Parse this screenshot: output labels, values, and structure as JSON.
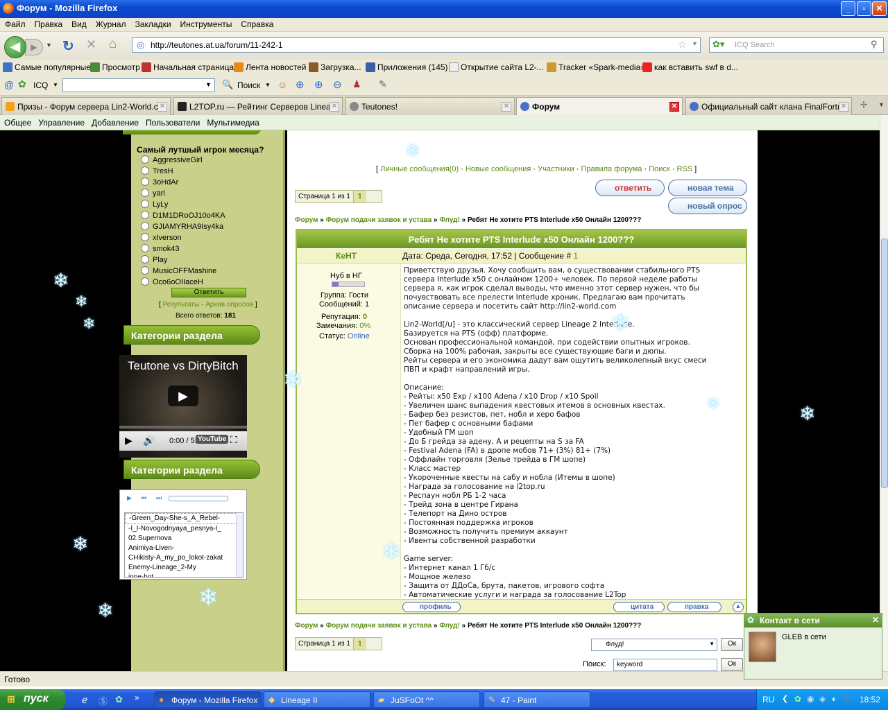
{
  "window": {
    "title": "Форум - Mozilla Firefox"
  },
  "menu": [
    "Файл",
    "Правка",
    "Вид",
    "Журнал",
    "Закладки",
    "Инструменты",
    "Справка"
  ],
  "url": "http://teutones.at.ua/forum/11-242-1",
  "search_placeholder": "ICQ Search",
  "bookmarks": [
    "Самые популярные",
    "Просмотр",
    "Начальная страница",
    "Лента новостей",
    "Загрузка...",
    "Приложения (145)",
    "Открытие сайта L2-...",
    "Tracker «Spark-media»",
    "как вставить swf в d..."
  ],
  "icqbar": {
    "icq_label": "ICQ",
    "search_label": "Поиск"
  },
  "tabs": [
    {
      "label": "Призы - Форум сервера Lin2-World.c...",
      "active": false
    },
    {
      "label": "L2TOP.ru — Рейтинг Серверов Linea...",
      "active": false
    },
    {
      "label": "Teutones!",
      "active": false
    },
    {
      "label": "Форум",
      "active": true
    },
    {
      "label": "Официальный сайт клана FinalFortr...",
      "active": false
    }
  ],
  "site_nav": [
    "Общее",
    "Управление",
    "Добавление",
    "Пользователи",
    "Мультимедиа"
  ],
  "sidebar": {
    "poll_question": "Самый лутшый игрок месяца?",
    "poll_options": [
      "AggressiveGirl",
      "TresH",
      "3oHdAr",
      "yarl",
      "LyLy",
      "D1M1DRoOJ10o4KA",
      "GJIAMYRHA9Isy4ka",
      "xIverson",
      "smok43",
      "Play",
      "MusicOFFMashine",
      "Oco6oOIIaceH"
    ],
    "vote_button": "Ответить",
    "results_link": "Результаты",
    "archive_link": "Архив опросов",
    "total_label": "Всего ответов:",
    "total_value": "181",
    "section_header_1": "Категории раздела",
    "section_header_2": "Категории раздела",
    "video_title": "Teutone vs DirtyBitch",
    "video_time": "0:00 / 5:0",
    "video_brand": "YouTube",
    "playlist": [
      "-Green_Day-She-s_A_Rebel-",
      "-I_I-Novogodnyaya_pesnya-I_",
      "02.Supernova",
      "Animiya-Liven-",
      "CHikisty-A_my_po_lokot-zakat",
      "Enemy-Lineage_2-My",
      "inne-hot"
    ]
  },
  "forum": {
    "top_links": [
      "Личные сообщения(0)",
      "Новые сообщения",
      "Участники",
      "Правила форума",
      "Поиск",
      "RSS"
    ],
    "btn_reply": "ответить",
    "btn_new_topic": "новая тема",
    "btn_new_poll": "новый опрос",
    "pager_label": "Страница 1 из 1",
    "pager_current": "1",
    "breadcrumb": [
      "Форум",
      "Форум подачи заявок и устава",
      "Флуд!"
    ],
    "topic_title": "Ребят Не хотите PTS Interlude x50 Онлайн 1200???",
    "author": "КеНТ",
    "post_date": "Дата: Среда, Сегодня, 17:52 | Сообщение # ",
    "post_num": "1",
    "author_rank": "Нуб в НГ",
    "author_group": "Группа: Гости",
    "author_posts": "Сообщений: 1",
    "rep_label": "Репутация: ",
    "rep_value": "0",
    "warn_label": "Замечания: ",
    "warn_value": "0%",
    "status_label": "Статус: ",
    "status_value": "Online",
    "post_lines": [
      "Приветствую друзья. Хочу сообщить вам, о существовании стабильного PTS",
      "сервера Interlude x50 с онлайном 1200+ человек. По первой неделе работы",
      "сервера я, как игрок сделал выводы, что именно этот сервер нужен, что бы",
      "почувствовать все прелести Interlude хроник. Предлагаю вам прочитать",
      "описание сервера и посетить сайт http://lin2-world.com",
      "",
      "Lin2-World[/u] - это классический сервер Lineage 2 Interlude.",
      "Базируется на PTS (офф) платформе.",
      "Основан профессиональной командой, при содействии опытных игроков.",
      "Сборка на 100% рабочая, закрыты все существующие баги и дюпы.",
      "Рейты сервера и его экономика дадут вам ощутить великолепный вкус смеси",
      "ПВП и крафт направлений игры.",
      "",
      "Описание:",
      "- Рейты: x50 Exp / x100 Adena / x10 Drop / x10 Spoil",
      "- Увеличен шанс выпадения квестовых итемов в основных квестах.",
      "- Бафер без резистов, пет, нобл и херо бафов",
      "- Пет бафер с основными бафами",
      "- Удобный ГМ шоп",
      "- До Б грейда за адену, А и рецепты на S за FA",
      "- Festival Adena (FA) в дропе мобов 71+ (3%) 81+ (7%)",
      "- Оффлайн торговля (Зелье трейда в ГМ шопе)",
      "- Класс мастер",
      "- Укороченные квесты на сабу и нобла (Итемы в шопе)",
      "- Награда за голосование на l2top.ru",
      "- Респаун нобл РБ 1-2 часа",
      "- Трейд зона в центре Гирана",
      "- Телепорт на Дино остров",
      "- Постоянная поддержка игроков",
      "- Возможность получить премиум аккаунт",
      "- Ивенты собственной разработки",
      "",
      "Game server:",
      "- Интернет канал 1 Гб/с",
      "- Мощное железо",
      "- Защита от ДДоСа, брута, пакетов, игрового софта",
      "- Автоматические услуги и награда за голосование L2Top"
    ],
    "btn_profile": "профиль",
    "btn_quote": "цитата",
    "btn_edit": "правка",
    "jump_select": "Флуд!",
    "ok_label": "Ок",
    "search_label": "Поиск:",
    "search_value": "keyword"
  },
  "status": "Готово",
  "contact_popup": {
    "title": "Контакт в сети",
    "text": "GLEB в сети"
  },
  "taskbar": {
    "start": "пуск",
    "items": [
      "Форум - Mozilla Firefox",
      "Lineage II",
      "JuSFoOt ^^",
      "47 - Paint"
    ],
    "lang": "RU",
    "clock": "18:52"
  },
  "colors": {
    "accent_green": "#5d8b14",
    "left_bg": "#c9d08a",
    "title_blue": "#0a4bd3"
  }
}
